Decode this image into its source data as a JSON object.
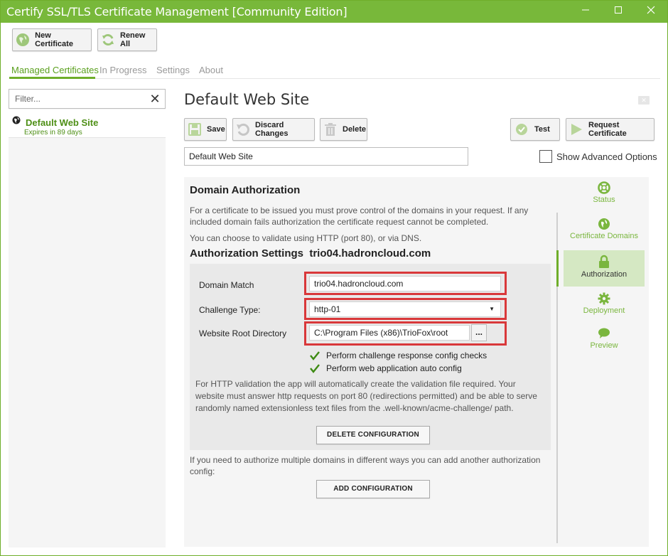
{
  "window": {
    "title": "Certify SSL/TLS Certificate Management [Community Edition]"
  },
  "toolbar": {
    "new_certificate": "New Certificate",
    "renew_all": "Renew All"
  },
  "tabs": [
    "Managed Certificates",
    "In Progress",
    "Settings",
    "About"
  ],
  "sidebar": {
    "filter_placeholder": "Filter...",
    "items": [
      {
        "name": "Default Web Site",
        "expiry": "Expires in 89 days"
      }
    ]
  },
  "editor": {
    "title": "Default Web Site",
    "actions": {
      "save": "Save",
      "discard": "Discard Changes",
      "delete": "Delete",
      "test": "Test",
      "request": "Request Certificate"
    },
    "name_value": "Default Web Site",
    "advanced_label": "Show Advanced Options"
  },
  "domain_auth": {
    "heading": "Domain Authorization",
    "intro": "For a certificate to be issued you must prove control of the domains in your request. If any included domain fails authorization the certificate request cannot be completed.",
    "choice": "You can choose to validate using HTTP (port 80), or via DNS.",
    "settings_heading": "Authorization Settings",
    "settings_domain": "trio04.hadroncloud.com",
    "domain_match_label": "Domain Match",
    "domain_match_value": "trio04.hadroncloud.com",
    "challenge_label": "Challenge Type:",
    "challenge_value": "http-01",
    "root_label": "Website Root Directory",
    "root_value": "C:\\Program Files (x86)\\TrioFox\\root",
    "browse_label": "...",
    "check1": "Perform challenge response config checks",
    "check2": "Perform web application auto config",
    "http_note": "For HTTP validation the app will automatically create the validation file required. Your website must answer http requests on port 80 (redirections permitted) and be able to serve randomly named extensionless text files from the .well-known/acme-challenge/ path.",
    "delete_config": "DELETE CONFIGURATION",
    "multi_note": "If you need to authorize multiple domains in different ways you can add another authorization config:",
    "add_config": "ADD CONFIGURATION"
  },
  "side_nav": {
    "status": "Status",
    "domains": "Certificate Domains",
    "authorization": "Authorization",
    "deployment": "Deployment",
    "preview": "Preview"
  },
  "colors": {
    "brand": "#78b83a",
    "accent_text": "#4e8f16",
    "highlight": "#d9383a"
  }
}
